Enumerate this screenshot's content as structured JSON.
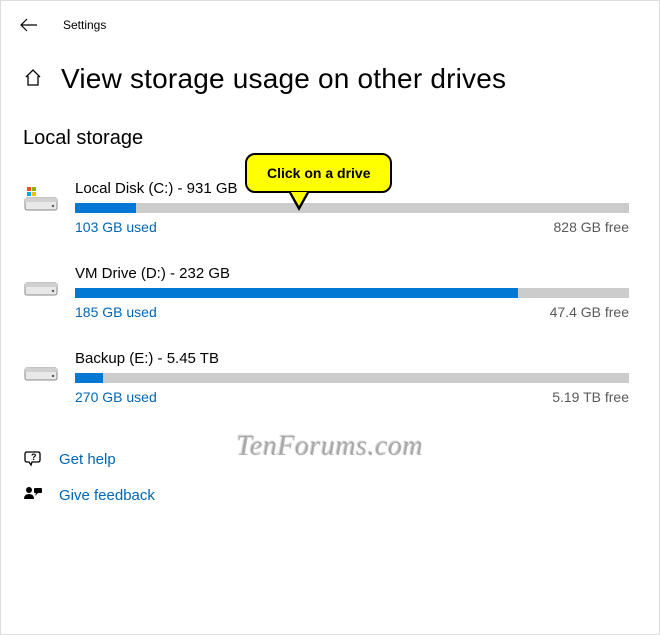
{
  "window": {
    "title": "Settings"
  },
  "page": {
    "title": "View storage usage on other drives"
  },
  "section": {
    "heading": "Local storage"
  },
  "callout": {
    "text": "Click on a drive"
  },
  "drives": [
    {
      "label": "Local Disk (C:) - 931 GB",
      "used": "103 GB used",
      "free": "828 GB free",
      "pct": 11,
      "system": true
    },
    {
      "label": "VM Drive (D:) - 232 GB",
      "used": "185 GB used",
      "free": "47.4 GB free",
      "pct": 80,
      "system": false
    },
    {
      "label": "Backup (E:) - 5.45 TB",
      "used": "270 GB used",
      "free": "5.19 TB free",
      "pct": 5,
      "system": false
    }
  ],
  "links": {
    "help": "Get help",
    "feedback": "Give feedback"
  },
  "watermark": "TenForums.com"
}
